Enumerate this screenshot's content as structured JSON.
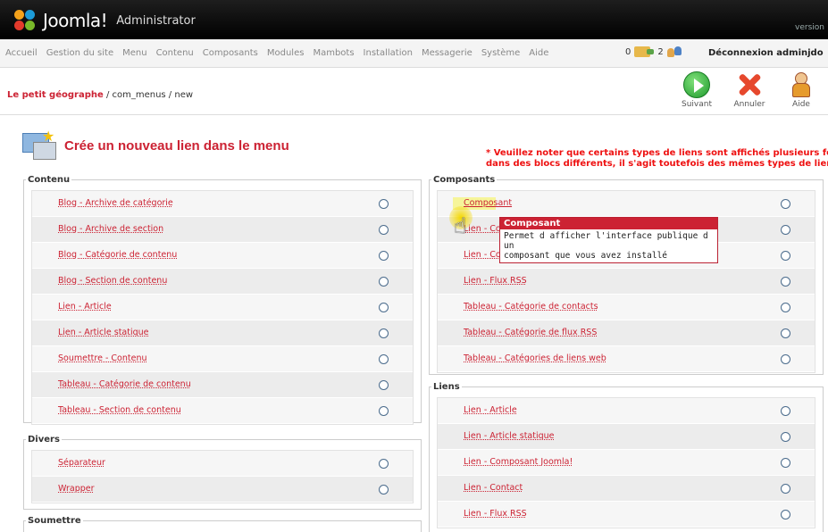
{
  "header": {
    "logo": "Joomla!",
    "subtitle": "Administrator",
    "version": "version"
  },
  "menu": {
    "items": [
      "Accueil",
      "Gestion du site",
      "Menu",
      "Contenu",
      "Composants",
      "Modules",
      "Mambots",
      "Installation",
      "Messagerie",
      "Système",
      "Aide"
    ]
  },
  "status": {
    "messages": "0",
    "users": "2",
    "logout": "Déconnexion adminjdo"
  },
  "breadcrumb": {
    "site": "Le petit géographe",
    "path": " / com_menus / new"
  },
  "toolbar": {
    "next": "Suivant",
    "cancel": "Annuler",
    "help": "Aide"
  },
  "page": {
    "title": "Crée un nouveau lien dans le menu",
    "note_line1": "* Veuillez noter que certains types de liens sont affichés plusieurs fois",
    "note_line2": "dans des blocs différents, il s'agit toutefois des mêmes types de lien."
  },
  "groups": {
    "contenu": {
      "title": "Contenu",
      "items": [
        "Blog - Archive de catégorie",
        "Blog - Archive de section",
        "Blog - Catégorie de contenu",
        "Blog - Section de contenu",
        "Lien - Article",
        "Lien - Article statique",
        "Soumettre - Contenu",
        "Tableau - Catégorie de contenu",
        "Tableau - Section de contenu"
      ]
    },
    "divers": {
      "title": "Divers",
      "items": [
        "Séparateur",
        "Wrapper"
      ]
    },
    "soumettre": {
      "title": "Soumettre",
      "items": []
    },
    "composants": {
      "title": "Composants",
      "items": [
        "Composant",
        "Lien - Composant",
        "Lien - Contact",
        "Lien - Flux RSS",
        "Tableau - Catégorie de contacts",
        "Tableau - Catégorie de flux RSS",
        "Tableau - Catégories de liens web"
      ]
    },
    "liens": {
      "title": "Liens",
      "items": [
        "Lien - Article",
        "Lien - Article statique",
        "Lien - Composant Joomla!",
        "Lien - Contact",
        "Lien - Flux RSS"
      ]
    }
  },
  "tooltip": {
    "title": "Composant",
    "line1": "Permet d afficher l'interface publique d un",
    "line2": "composant que vous avez installé"
  }
}
